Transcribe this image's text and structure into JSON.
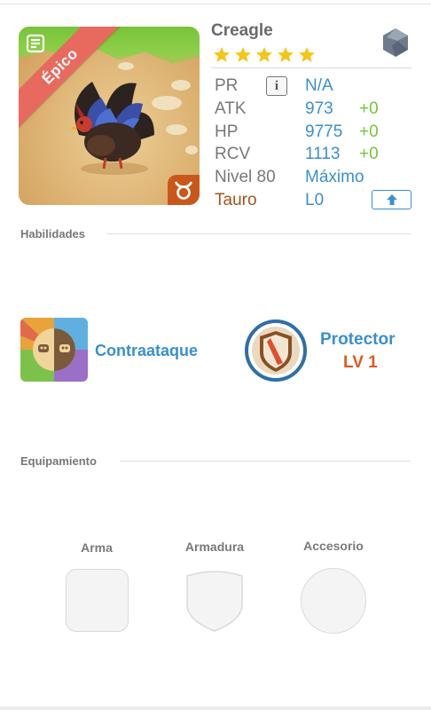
{
  "character": {
    "name": "Creagle",
    "rarity_label": "Épico",
    "stars": 5
  },
  "stats": {
    "pr": {
      "label": "PR",
      "value": "N/A"
    },
    "atk": {
      "label": "ATK",
      "value": "973",
      "bonus": "+0"
    },
    "hp": {
      "label": "HP",
      "value": "9775",
      "bonus": "+0"
    },
    "rcv": {
      "label": "RCV",
      "value": "1113",
      "bonus": "+0"
    },
    "level": {
      "label": "Nivel 80",
      "value": "Máximo"
    },
    "zodiac": {
      "label": "Tauro",
      "value": "L0"
    }
  },
  "sections": {
    "skills_title": "Habilidades",
    "equipment_title": "Equipamiento"
  },
  "skills": {
    "active_name": "Contraataque",
    "leader_name": "Protector",
    "leader_level": "LV 1"
  },
  "equipment": {
    "weapon_label": "Arma",
    "armor_label": "Armadura",
    "accessory_label": "Accesorio"
  },
  "icons": {
    "rarity_ribbon": "ribbon",
    "document": "document-icon",
    "zodiac": "taurus-icon",
    "gem": "gem-icon",
    "info": "info-icon",
    "upgrade": "arrow-up-icon"
  },
  "colors": {
    "accent_blue": "#3a8fd0",
    "bonus_green": "#77c43b",
    "zodiac_brown": "#a4521d",
    "rarity_red": "#e86a5e",
    "star_yellow": "#f5c518",
    "level_orange": "#e0591e"
  }
}
